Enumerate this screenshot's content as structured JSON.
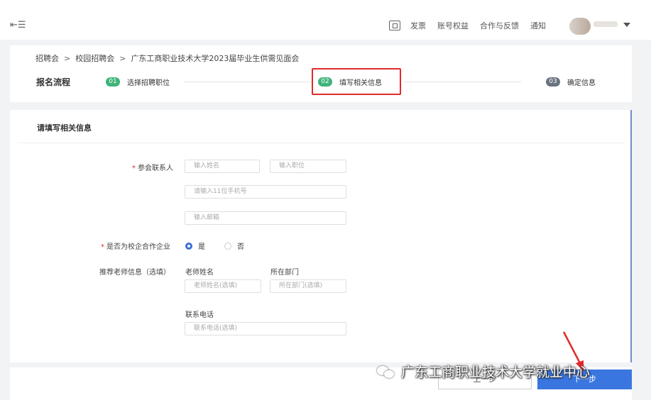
{
  "header": {
    "collapse_icon": "menu-fold-icon",
    "scan_icon": "scan-icon",
    "links": [
      "发票",
      "账号权益",
      "合作与反馈",
      "通知"
    ]
  },
  "breadcrumb": [
    "招聘会",
    "校园招聘会",
    "广东工商职业技术大学2023届毕业生供需见面会"
  ],
  "steps": {
    "title": "报名流程",
    "items": [
      {
        "num": "01",
        "label": "选择招聘职位",
        "status": "done"
      },
      {
        "num": "02",
        "label": "填写相关信息",
        "status": "current"
      },
      {
        "num": "03",
        "label": "确定信息",
        "status": "pending"
      }
    ],
    "highlight_color": "#e02a2a"
  },
  "form": {
    "title": "请填写相关信息",
    "contact": {
      "label": "参会联系人",
      "name_placeholder": "输入姓名",
      "position_placeholder": "输入职位",
      "phone_placeholder": "请输入11位手机号",
      "email_placeholder": "输入邮箱"
    },
    "cooperation": {
      "label": "是否为校企合作企业",
      "options": [
        {
          "label": "是",
          "checked": true
        },
        {
          "label": "否",
          "checked": false
        }
      ]
    },
    "teacher": {
      "label": "推荐老师信息（选填）",
      "name_label": "老师姓名",
      "name_placeholder": "老师姓名(选填)",
      "dept_label": "所在部门",
      "dept_placeholder": "所在部门(选填)",
      "phone_label": "联系电话",
      "phone_placeholder": "联系电话(选填)"
    },
    "required_mark": "*"
  },
  "footer": {
    "prev_label": "上一步",
    "next_label": "下一步",
    "accent": "#3a76e0"
  },
  "watermark": {
    "icon": "wechat-icon",
    "text": "广东工商职业技术大学就业中心"
  }
}
